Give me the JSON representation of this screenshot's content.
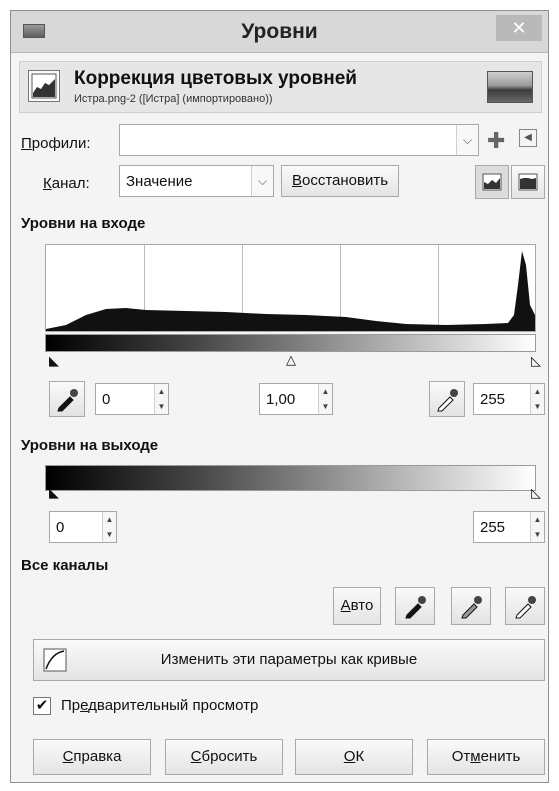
{
  "window": {
    "title": "Уровни",
    "close_glyph": "✕"
  },
  "header": {
    "title": "Коррекция цветовых уровней",
    "subtitle": "Истра.png-2 ([Истра] (импортировано))"
  },
  "profiles": {
    "label_first": "П",
    "label_rest": "рофили:",
    "value": ""
  },
  "channel": {
    "label_first": "К",
    "label_rest": "анал:",
    "value": "Значение",
    "restore_first": "В",
    "restore_rest": "осстановить"
  },
  "input_levels": {
    "title": "Уровни на входе",
    "black": "0",
    "gamma": "1,00",
    "white": "255"
  },
  "output_levels": {
    "title": "Уровни на выходе",
    "black": "0",
    "white": "255"
  },
  "all_channels": {
    "title": "Все каналы",
    "auto_first": "А",
    "auto_rest": "вто",
    "curves_label": "Изменить эти параметры как кривые"
  },
  "preview": {
    "checked": true,
    "label_first": "Пр",
    "label_u": "е",
    "label_rest": "дварительный просмотр"
  },
  "buttons": {
    "help_first": "С",
    "help_rest": "правка",
    "reset_first": "С",
    "reset_rest": "бросить",
    "ok_first": "О",
    "ok_rest": "К",
    "cancel_first": "От",
    "cancel_u": "м",
    "cancel_rest": "енить"
  },
  "icons": [
    "app-icon",
    "close-icon",
    "levels-icon",
    "image-thumbnail",
    "add-icon",
    "menu-arrow-icon",
    "linear-histogram-icon",
    "log-histogram-icon",
    "black-eyedropper-icon",
    "gray-eyedropper-icon",
    "white-eyedropper-icon",
    "curves-icon",
    "checkmark-icon"
  ]
}
